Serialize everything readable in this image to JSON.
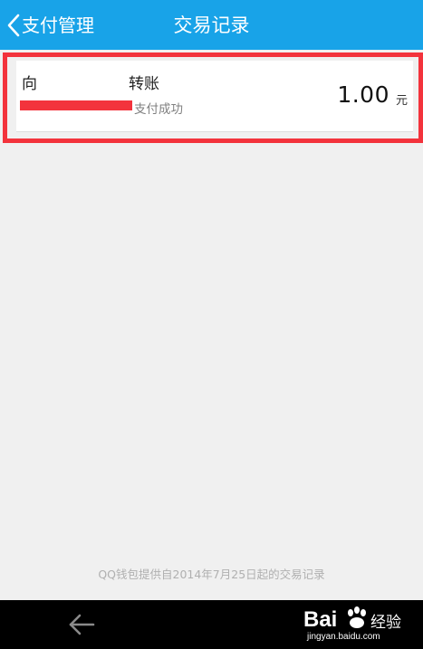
{
  "header": {
    "back_label": "支付管理",
    "title": "交易记录",
    "bg_color": "#18a3e8"
  },
  "record": {
    "prefix": "向",
    "suffix": "转账",
    "status": "支付成功",
    "amount": "1.00",
    "unit": "元",
    "highlight_color": "#f3333c"
  },
  "footer_note": "QQ钱包提供自2014年7月25日起的交易记录",
  "bottom_bar": {
    "back_icon": "arrow-left-icon"
  },
  "watermark": {
    "brand": "Bai",
    "cn": "经验",
    "url": "jingyan.baidu.com"
  }
}
